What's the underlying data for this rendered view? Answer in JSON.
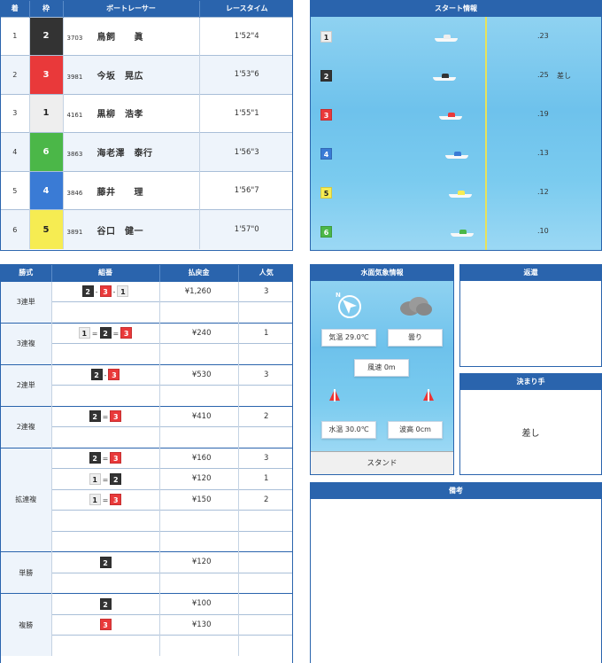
{
  "results": {
    "headers": [
      "着",
      "枠",
      "ボートレーサー",
      "レースタイム"
    ],
    "rows": [
      {
        "rank": "1",
        "waku": "2",
        "reg": "3703",
        "name": "鳥飼　　眞",
        "time": "1'52\"4"
      },
      {
        "rank": "2",
        "waku": "3",
        "reg": "3981",
        "name": "今坂　晃広",
        "time": "1'53\"6"
      },
      {
        "rank": "3",
        "waku": "1",
        "reg": "4161",
        "name": "黒柳　浩孝",
        "time": "1'55\"1"
      },
      {
        "rank": "4",
        "waku": "6",
        "reg": "3863",
        "name": "海老澤　泰行",
        "time": "1'56\"3"
      },
      {
        "rank": "5",
        "waku": "4",
        "reg": "3846",
        "name": "藤井　　理",
        "time": "1'56\"7"
      },
      {
        "rank": "6",
        "waku": "5",
        "reg": "3891",
        "name": "谷口　健一",
        "time": "1'57\"0"
      }
    ]
  },
  "start_info": {
    "title": "スタート情報",
    "rows": [
      {
        "waku": "1",
        "st": ".23",
        "kimarite": ""
      },
      {
        "waku": "2",
        "st": ".25",
        "kimarite": "差し"
      },
      {
        "waku": "3",
        "st": ".19",
        "kimarite": ""
      },
      {
        "waku": "4",
        "st": ".13",
        "kimarite": ""
      },
      {
        "waku": "5",
        "st": ".12",
        "kimarite": ""
      },
      {
        "waku": "6",
        "st": ".10",
        "kimarite": ""
      }
    ]
  },
  "payouts": {
    "headers": [
      "勝式",
      "組番",
      "払戻金",
      "人気"
    ],
    "groups": [
      {
        "type": "3連単",
        "rows": [
          {
            "combo": [
              "2",
              "-",
              "3",
              "-",
              "1"
            ],
            "amount": "¥1,260",
            "pop": "3"
          },
          null
        ]
      },
      {
        "type": "3連複",
        "rows": [
          {
            "combo": [
              "1",
              "=",
              "2",
              "=",
              "3"
            ],
            "amount": "¥240",
            "pop": "1"
          },
          null
        ]
      },
      {
        "type": "2連単",
        "rows": [
          {
            "combo": [
              "2",
              "-",
              "3"
            ],
            "amount": "¥530",
            "pop": "3"
          },
          null
        ]
      },
      {
        "type": "2連複",
        "rows": [
          {
            "combo": [
              "2",
              "=",
              "3"
            ],
            "amount": "¥410",
            "pop": "2"
          },
          null
        ]
      },
      {
        "type": "拡連複",
        "rows": [
          {
            "combo": [
              "2",
              "=",
              "3"
            ],
            "amount": "¥160",
            "pop": "3"
          },
          {
            "combo": [
              "1",
              "=",
              "2"
            ],
            "amount": "¥120",
            "pop": "1"
          },
          {
            "combo": [
              "1",
              "=",
              "3"
            ],
            "amount": "¥150",
            "pop": "2"
          },
          null,
          null
        ]
      },
      {
        "type": "単勝",
        "rows": [
          {
            "combo": [
              "2"
            ],
            "amount": "¥120",
            "pop": ""
          },
          null
        ]
      },
      {
        "type": "複勝",
        "rows": [
          {
            "combo": [
              "2"
            ],
            "amount": "¥100",
            "pop": ""
          },
          {
            "combo": [
              "3"
            ],
            "amount": "¥130",
            "pop": ""
          },
          null
        ]
      }
    ]
  },
  "weather": {
    "title": "水面気象情報",
    "compass_label": "N",
    "weather_text": "曇り",
    "temp": "気温 29.0℃",
    "wind": "風速 0m",
    "water_temp": "水温 30.0℃",
    "wave": "波高 0cm",
    "stand": "スタンド",
    "icons": {
      "wind": "compass-arrow-icon",
      "weather": "cloud-icon",
      "buoy": "buoy-icon"
    }
  },
  "henkan": {
    "title": "返還",
    "content": ""
  },
  "kimarite": {
    "title": "決まり手",
    "value": "差し"
  },
  "biko": {
    "title": "備考",
    "content": ""
  },
  "colors": {
    "header": "#2a64ad",
    "waku1": "#eeeeee",
    "waku2": "#333333",
    "waku3": "#e9393a",
    "waku4": "#3a7bd5",
    "waku5": "#f6ec52",
    "waku6": "#4bb748"
  }
}
